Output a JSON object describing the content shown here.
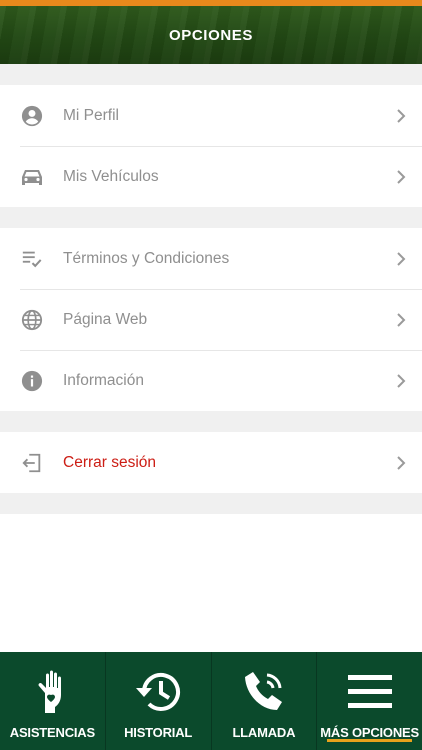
{
  "header": {
    "title": "OPCIONES"
  },
  "groups": [
    {
      "items": [
        {
          "label": "Mi Perfil",
          "icon": "account-circle-icon"
        },
        {
          "label": "Mis Vehículos",
          "icon": "car-icon"
        }
      ]
    },
    {
      "items": [
        {
          "label": "Términos y Condiciones",
          "icon": "list-check-icon"
        },
        {
          "label": "Página Web",
          "icon": "globe-icon"
        },
        {
          "label": "Información",
          "icon": "info-icon"
        }
      ]
    },
    {
      "items": [
        {
          "label": "Cerrar sesión",
          "icon": "logout-icon"
        }
      ]
    }
  ],
  "tabs": [
    {
      "label": "ASISTENCIAS",
      "icon": "hand-icon"
    },
    {
      "label": "HISTORIAL",
      "icon": "history-icon"
    },
    {
      "label": "LLAMADA",
      "icon": "phone-icon"
    },
    {
      "label": "MÁS OPCIONES",
      "icon": "menu-icon",
      "active": true
    }
  ],
  "colors": {
    "header": "#234a15",
    "accent": "#e8891c",
    "tabbar": "#0b4a2c",
    "danger": "#cc1d14",
    "label": "#8f8f8f"
  }
}
